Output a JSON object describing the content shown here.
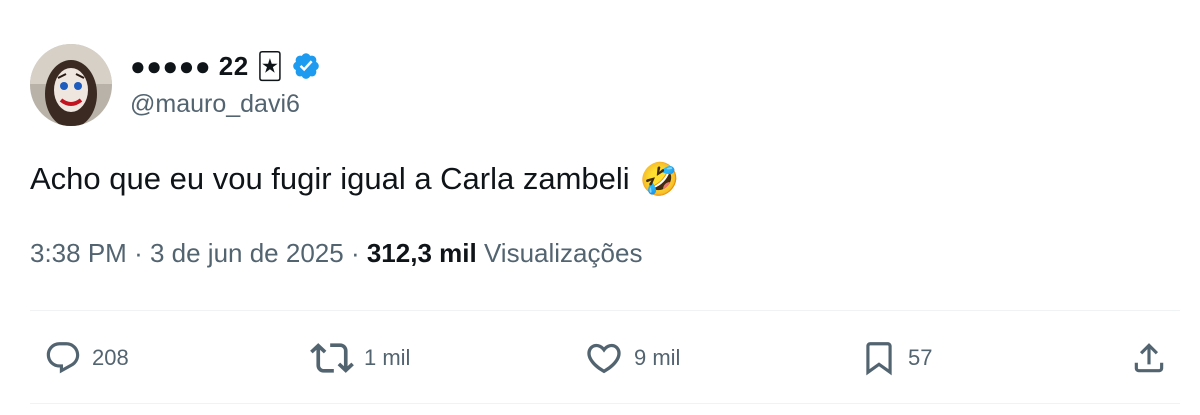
{
  "author": {
    "display_name": "●●●●● 22",
    "handle": "@mauro_davi6",
    "badge_emoji": "🃏",
    "verified_color": "#1d9bf0"
  },
  "tweet": {
    "text": "Acho que eu vou fugir igual a Carla zambeli",
    "emoji": "🤣",
    "time": "3:38 PM",
    "separator": "·",
    "date": "3 de jun de 2025",
    "views_count": "312,3 mil",
    "views_label": "Visualizações"
  },
  "actions": {
    "replies": "208",
    "reposts": "1 mil",
    "likes": "9 mil",
    "bookmarks": "57"
  },
  "icons": [
    "avatar",
    "jester-emoji-icon",
    "verified-badge-icon",
    "rofl-emoji-icon",
    "reply-icon",
    "repost-icon",
    "like-icon",
    "bookmark-icon",
    "share-icon"
  ],
  "colors": {
    "text_primary": "#0f1419",
    "text_secondary": "#536471",
    "divider": "#eff3f4"
  }
}
